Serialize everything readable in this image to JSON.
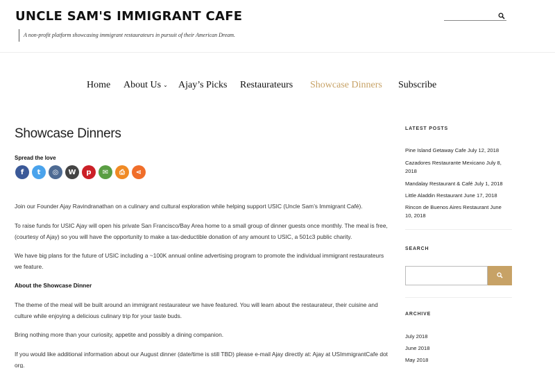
{
  "header": {
    "site_title": "UNCLE SAM'S IMMIGRANT CAFE",
    "tagline": "A non-profit platform showcasing immigrant restaurateurs in pursuit of their American Dream.",
    "search_icon": "search-icon"
  },
  "nav": {
    "items": [
      {
        "label": "Home"
      },
      {
        "label": "About Us",
        "has_dropdown": true
      },
      {
        "label": "Ajay’s Picks"
      },
      {
        "label": "Restaurateurs"
      },
      {
        "label": "Showcase Dinners",
        "active": true
      },
      {
        "label": "Subscribe"
      }
    ],
    "active_color": "#c7a266"
  },
  "main": {
    "title": "Showcase Dinners",
    "spread_label": "Spread the love",
    "share_buttons": [
      {
        "name": "facebook",
        "glyph": "f",
        "color": "#3b5998"
      },
      {
        "name": "twitter",
        "glyph": "t",
        "color": "#4aa3ec"
      },
      {
        "name": "instagram",
        "glyph": "◎",
        "color": "#4e6b93"
      },
      {
        "name": "wordpress",
        "glyph": "W",
        "color": "#444444"
      },
      {
        "name": "pinterest",
        "glyph": "p",
        "color": "#cb2027"
      },
      {
        "name": "email",
        "glyph": "✉",
        "color": "#5a9e43"
      },
      {
        "name": "print",
        "glyph": "⎙",
        "color": "#f08a24"
      },
      {
        "name": "share",
        "glyph": "⋖",
        "color": "#f06e2a"
      }
    ],
    "paragraphs": [
      "Join our Founder Ajay Ravindranathan on a culinary and cultural exploration while helping support USIC (Uncle Sam’s Immigrant Café).",
      "To raise funds for USIC Ajay will open his private San Francisco/Bay Area home to a small group of dinner guests once monthly. The meal is free, (courtesy of Ajay) so you will have the opportunity to make a tax-deductible donation of any amount to USIC, a 501c3 public charity.",
      "We have big plans for the future of USIC including a ~100K annual online advertising program to promote the individual immigrant restaurateurs we feature.",
      "About the Showcase Dinner",
      "The theme of the meal will be built around an immigrant restaurateur we have featured.  You will learn about the restaurateur, their cuisine and culture while enjoying a delicious culinary trip for your taste buds.",
      "Bring nothing more than your curiosity, appetite and possibly a dining companion.",
      "If you would like additional information about our August dinner (date/time is still TBD) please e-mail Ajay directly at: Ajay at USImmigrantCafe dot org."
    ]
  },
  "sidebar": {
    "latest_title": "LATEST POSTS",
    "posts": [
      "Pine Island Getaway Cafe July 12, 2018",
      "Cazadores Restaurante Mexicano  July 8, 2018",
      "Mandalay Restaurant & Café July 1, 2018",
      "Little Aladdin Restaurant June 17, 2018",
      "Rincon de Buenos Aires Restaurant June 10, 2018"
    ],
    "search_title": "SEARCH",
    "archive_title": "ARCHIVE",
    "archives": [
      "July 2018",
      "June 2018",
      "May 2018"
    ]
  }
}
